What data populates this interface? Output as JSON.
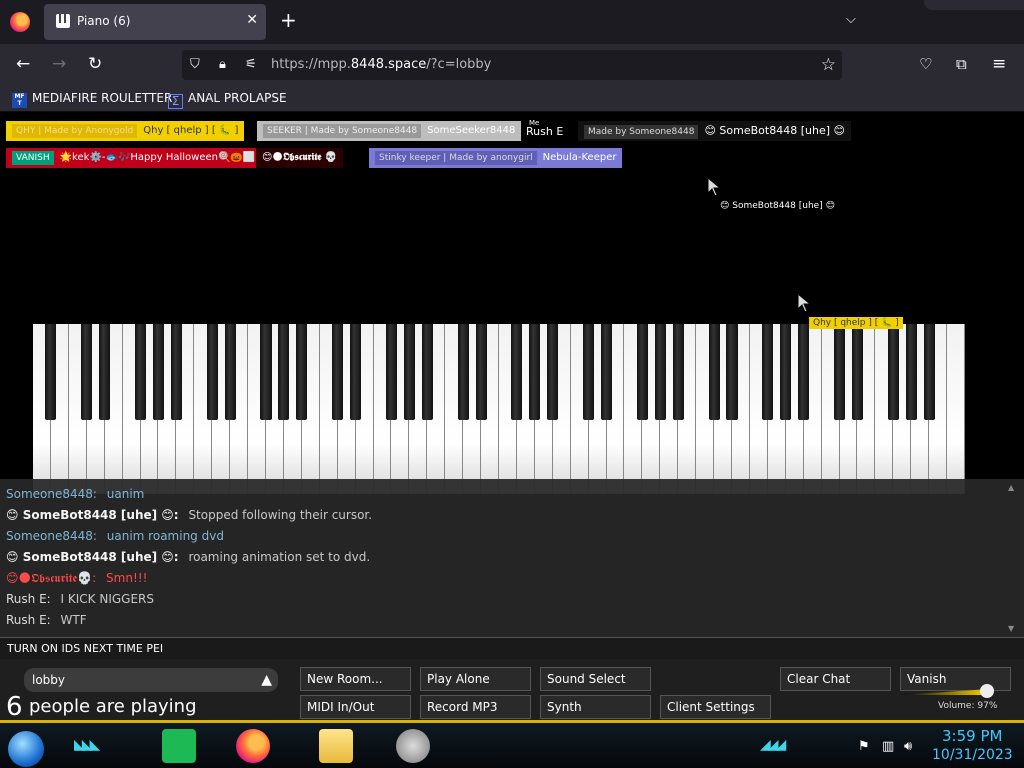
{
  "browser": {
    "tab_title": "Piano (6)",
    "tab_close": "✕",
    "new_tab": "+",
    "tab_list": "⌵",
    "url_prefix": "https://mpp.",
    "url_domain": "8448.space",
    "url_suffix": "/?c=lobby",
    "bookmarks": [
      {
        "label": "MEDIAFIRE ROULETTER",
        "icon_text": "MF T"
      },
      {
        "label": "ANAL PROLAPSE",
        "icon_text": "Σ"
      }
    ]
  },
  "players": [
    {
      "prefix": "QHY | Made by Anonygold",
      "name": "Qhy [ qhelp ] [ 🐛 ]"
    },
    {
      "prefix": "SEEKER | Made by Someone8448",
      "name": "SomeSeeker8448"
    },
    {
      "prefix": "Me",
      "name": "Rush E"
    },
    {
      "prefix": "Made by Someone8448",
      "name": "😊 SomeBot8448 [uhe] 😊"
    },
    {
      "prefix": "VANISH",
      "name": "🌟kek⚙️-🐟🎶Happy Halloween🍭🎃⬜"
    },
    {
      "prefix": "",
      "name": "😊🌑𝕺𝖇𝖘𝖈𝖚𝖗𝖎𝖙𝖊 💀"
    },
    {
      "prefix": "Stinky keeper | Made by anonygirl",
      "name": "Nebula-Keeper"
    }
  ],
  "cursors": [
    {
      "label": "😊 SomeBot8448 [uhe] 😊"
    },
    {
      "label": "Qhy [ qhelp ] [ 🐛 ]"
    }
  ],
  "chat": {
    "messages": [
      {
        "author": "Someone8448:",
        "text": "uanim"
      },
      {
        "author": "😊 SomeBot8448 [uhe] 😊:",
        "text": "Stopped following their cursor."
      },
      {
        "author": "Someone8448:",
        "text": "uanim roaming dvd"
      },
      {
        "author": "😊 SomeBot8448 [uhe] 😊:",
        "text": "roaming animation set to dvd."
      },
      {
        "author": "😊🌑𝕺𝖇𝖘𝖈𝖚𝖗𝖎𝖙𝖊💀:",
        "text": "Smn!!!"
      },
      {
        "author": "Rush E:",
        "text": "I KICK NIGGERS"
      },
      {
        "author": "Rush E:",
        "text": "WTF"
      }
    ],
    "input_value": "TURN ON IDS NEXT TIME PEI"
  },
  "controls": {
    "room": "lobby",
    "room_arrow": "▲",
    "player_count": "6",
    "player_count_label": "people are playing",
    "buttons": {
      "new_room": "New Room...",
      "play_alone": "Play Alone",
      "sound_select": "Sound Select",
      "midi": "MIDI In/Out",
      "record_mp3": "Record MP3",
      "synth": "Synth",
      "client_settings": "Client Settings",
      "clear_chat": "Clear Chat",
      "vanish": "Vanish"
    },
    "volume_label": "Volume: 97%",
    "volume_level": 0.97
  },
  "taskbar": {
    "time": "3:59 PM",
    "date": "10/31/2023"
  },
  "colors": {
    "accent_yellow": "#d9b300",
    "chat_name_blue": "#7fb7d6"
  }
}
